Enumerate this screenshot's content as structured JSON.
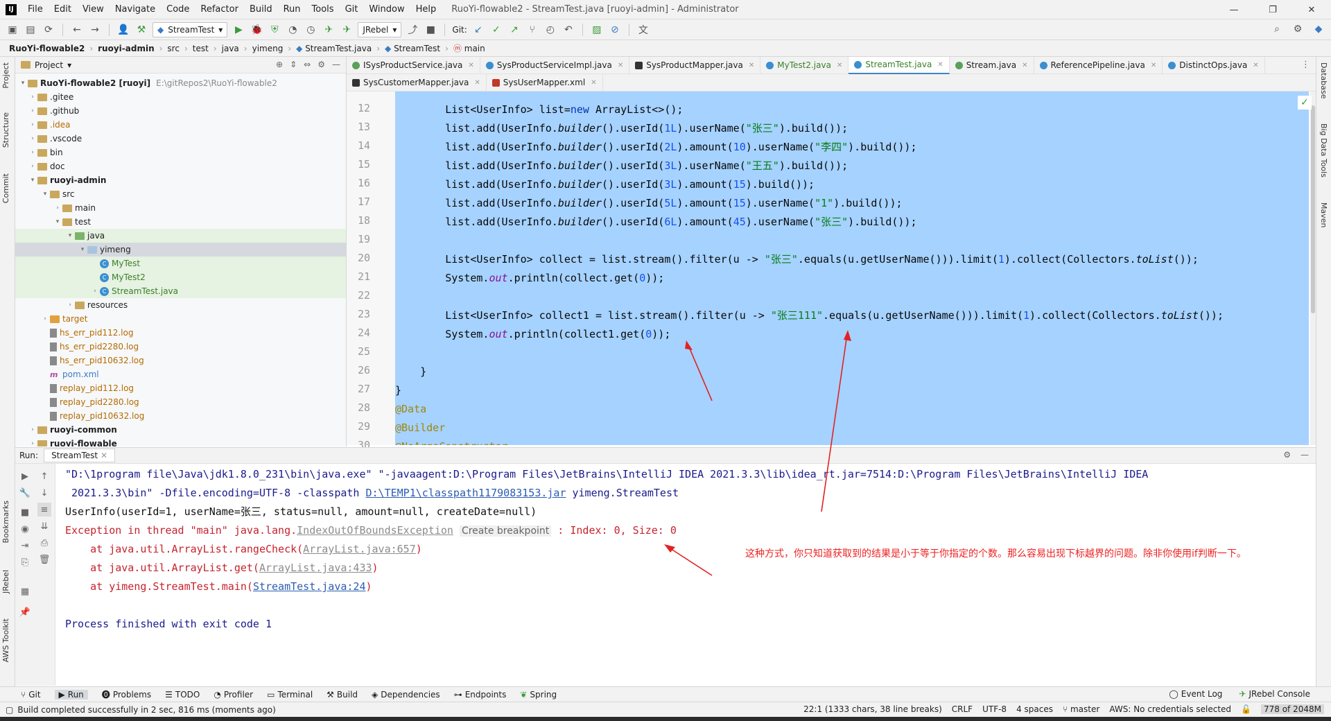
{
  "window": {
    "title": "RuoYi-flowable2 - StreamTest.java [ruoyi-admin] - Administrator",
    "menu": [
      "File",
      "Edit",
      "View",
      "Navigate",
      "Code",
      "Refactor",
      "Build",
      "Run",
      "Tools",
      "Git",
      "Window",
      "Help"
    ],
    "logo": "IJ"
  },
  "toolbar": {
    "run_config": "StreamTest",
    "jrebel": "JRebel",
    "git_label": "Git:"
  },
  "breadcrumb": [
    "RuoYi-flowable2",
    "ruoyi-admin",
    "src",
    "test",
    "java",
    "yimeng",
    "StreamTest.java",
    "StreamTest",
    "main"
  ],
  "left_stripe": [
    "Project",
    "Structure",
    "Commit",
    "Bookmarks",
    "JRebel",
    "AWS Toolkit"
  ],
  "right_stripe": [
    "Database",
    "Big Data Tools",
    "Maven"
  ],
  "project": {
    "header": "Project",
    "tree": [
      {
        "label": "RuoYi-flowable2 [ruoyi]",
        "extra": "E:\\gitRepos2\\RuoYi-flowable2"
      },
      {
        "label": ".gitee"
      },
      {
        "label": ".github"
      },
      {
        "label": ".idea"
      },
      {
        "label": ".vscode"
      },
      {
        "label": "bin"
      },
      {
        "label": "doc"
      },
      {
        "label": "ruoyi-admin"
      },
      {
        "label": "src"
      },
      {
        "label": "main"
      },
      {
        "label": "test"
      },
      {
        "label": "java"
      },
      {
        "label": "yimeng"
      },
      {
        "label": "MyTest"
      },
      {
        "label": "MyTest2"
      },
      {
        "label": "StreamTest.java"
      },
      {
        "label": "resources"
      },
      {
        "label": "target"
      },
      {
        "label": "hs_err_pid112.log"
      },
      {
        "label": "hs_err_pid2280.log"
      },
      {
        "label": "hs_err_pid10632.log"
      },
      {
        "label": "pom.xml"
      },
      {
        "label": "replay_pid112.log"
      },
      {
        "label": "replay_pid2280.log"
      },
      {
        "label": "replay_pid10632.log"
      },
      {
        "label": "ruoyi-common"
      },
      {
        "label": "ruoyi-flowable"
      }
    ]
  },
  "editor_tabs": {
    "row1": [
      "ISysProductService.java",
      "SysProductServiceImpl.java",
      "SysProductMapper.java",
      "MyTest2.java",
      "StreamTest.java",
      "Stream.java",
      "ReferencePipeline.java",
      "DistinctOps.java"
    ],
    "row2": [
      "SysCustomerMapper.java",
      "SysUserMapper.xml"
    ]
  },
  "editor": {
    "line_numbers": [
      "12",
      "13",
      "14",
      "15",
      "16",
      "17",
      "18",
      "19",
      "20",
      "21",
      "22",
      "23",
      "24",
      "25",
      "26",
      "27",
      "28",
      "29",
      "30"
    ]
  },
  "run": {
    "label": "Run:",
    "tab": "StreamTest",
    "console": {
      "line1": "\"D:\\1program file\\Java\\jdk1.8.0_231\\bin\\java.exe\" \"-javaagent:D:\\Program Files\\JetBrains\\IntelliJ IDEA 2021.3.3\\lib\\idea_rt.jar=7514:D:\\Program Files\\JetBrains\\IntelliJ IDEA",
      "line2a": " 2021.3.3\\bin\" -Dfile.encoding=UTF-8 -classpath ",
      "line2b": "D:\\TEMP1\\classpath1179083153.jar",
      "line2c": " yimeng.StreamTest",
      "line3": "UserInfo(userId=1, userName=张三, status=null, amount=null, createDate=null)",
      "line4a": "Exception in thread \"main\" java.lang.",
      "line4b": "IndexOutOfBoundsException",
      "line4hint": "Create breakpoint",
      "line4c": " : Index: 0, Size: 0",
      "line5a": "    at java.util.ArrayList.rangeCheck(",
      "line5b": "ArrayList.java:657",
      "line5c": ")",
      "line6a": "    at java.util.ArrayList.get(",
      "line6b": "ArrayList.java:433",
      "line6c": ")",
      "line7a": "    at yimeng.StreamTest.main(",
      "line7b": "StreamTest.java:24",
      "line7c": ")",
      "line8": "Process finished with exit code 1"
    },
    "annotation": "这种方式，你只知道获取到的结果是小于等于你指定的个数。那么容易出现下标越界的问题。除非你使用if判断一下。"
  },
  "bottom_tabs": [
    "Git",
    "Run",
    "Problems",
    "TODO",
    "Profiler",
    "Terminal",
    "Build",
    "Dependencies",
    "Endpoints",
    "Spring"
  ],
  "bottom_right_tabs": [
    "Event Log",
    "JRebel Console"
  ],
  "status": {
    "message": "Build completed successfully in 2 sec, 816 ms (moments ago)",
    "position": "22:1 (1333 chars, 38 line breaks)",
    "line_sep": "CRLF",
    "encoding": "UTF-8",
    "indent": "4 spaces",
    "branch": "master",
    "aws": "AWS: No credentials selected",
    "memory": "778 of 2048M"
  },
  "colors": {
    "selection": "#a6d2ff",
    "annotation_red": "#e22222",
    "keyword": "#0033b3",
    "string": "#067d17"
  }
}
